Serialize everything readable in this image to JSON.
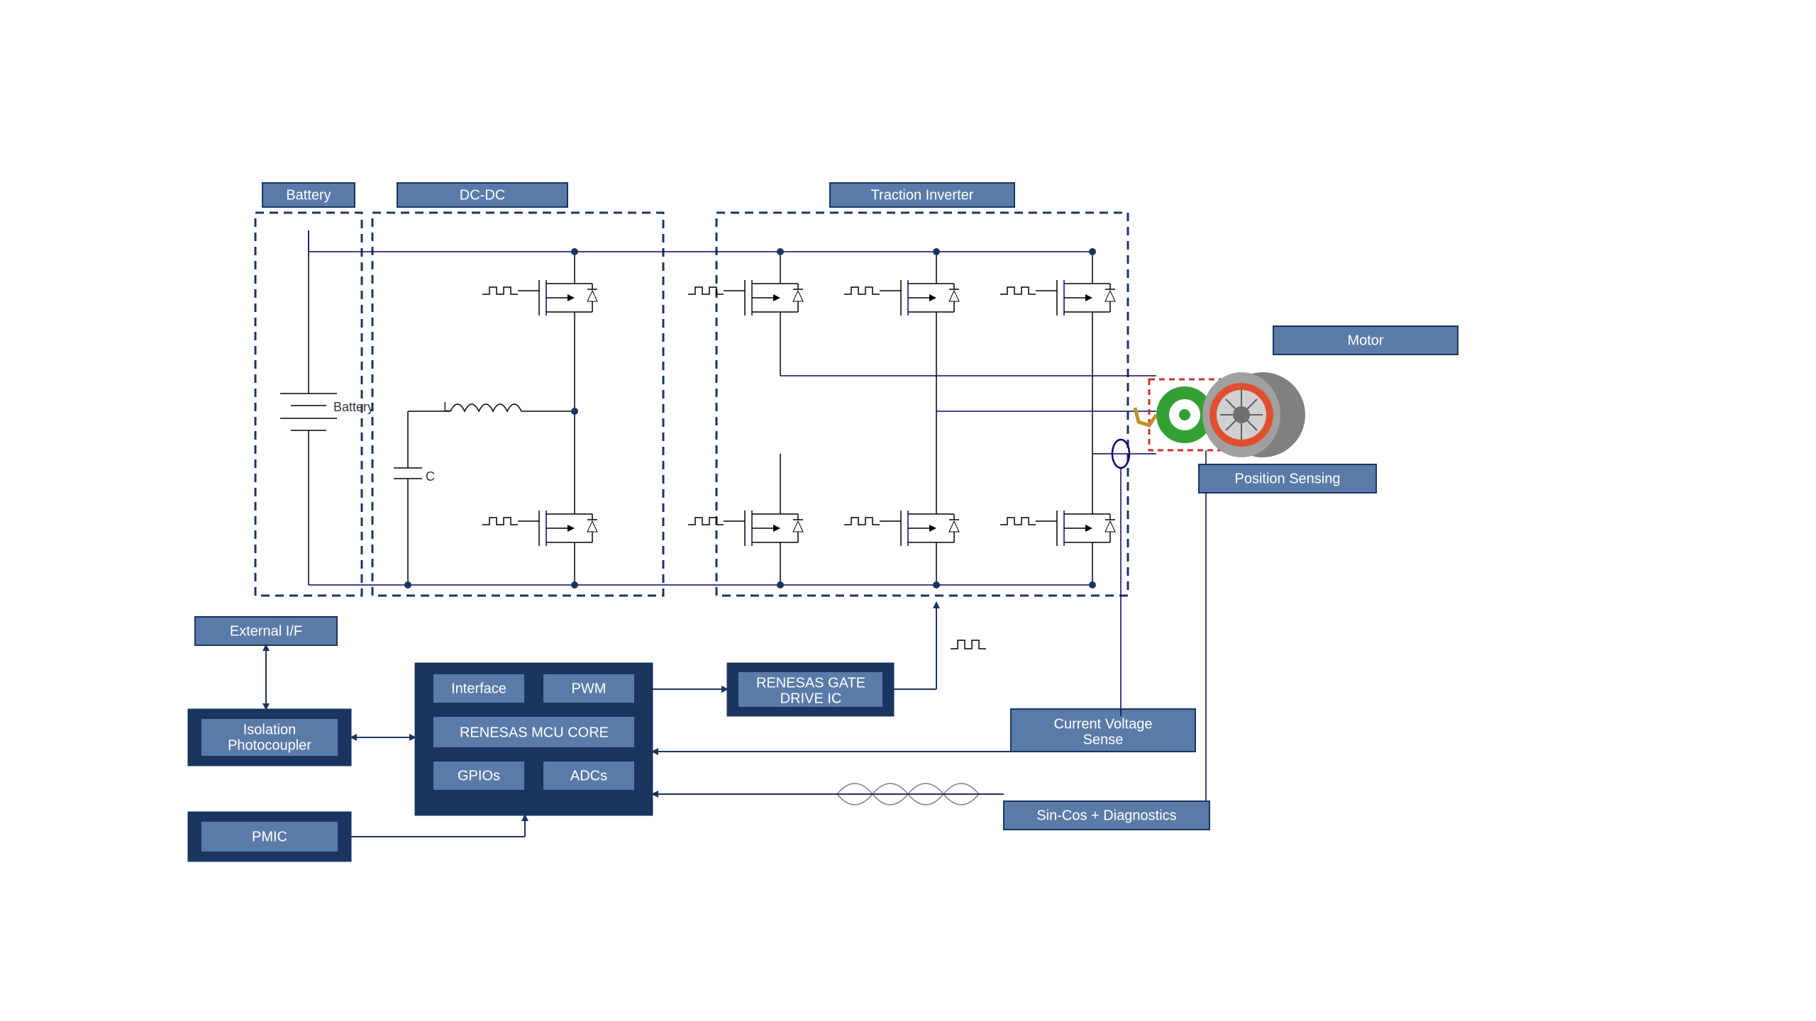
{
  "labels": {
    "battery_title": "Battery",
    "dcdc_title": "DC-DC",
    "inverter_title": "Traction Inverter",
    "motor_title": "Motor",
    "position_sensing": "Position Sensing",
    "external_if": "External I/F",
    "isolation_photocoupler": "Isolation\nPhotocoupler",
    "pmic": "PMIC",
    "interface": "Interface",
    "pwm": "PWM",
    "mcu_core": "RENESAS MCU CORE",
    "gpios": "GPIOs",
    "adcs": "ADCs",
    "gate_drive": "RENESAS GATE\nDRIVE IC",
    "current_voltage": "Current Voltage\nSense",
    "sincos": "Sin-Cos + Diagnostics",
    "battery_text": "Battery",
    "l_text": "L",
    "c_text": "C"
  },
  "colors": {
    "label_fill": "#5a7ba8",
    "label_stroke": "#1a3560",
    "solid_fill": "#1a3560",
    "wire": "#0b0065"
  }
}
